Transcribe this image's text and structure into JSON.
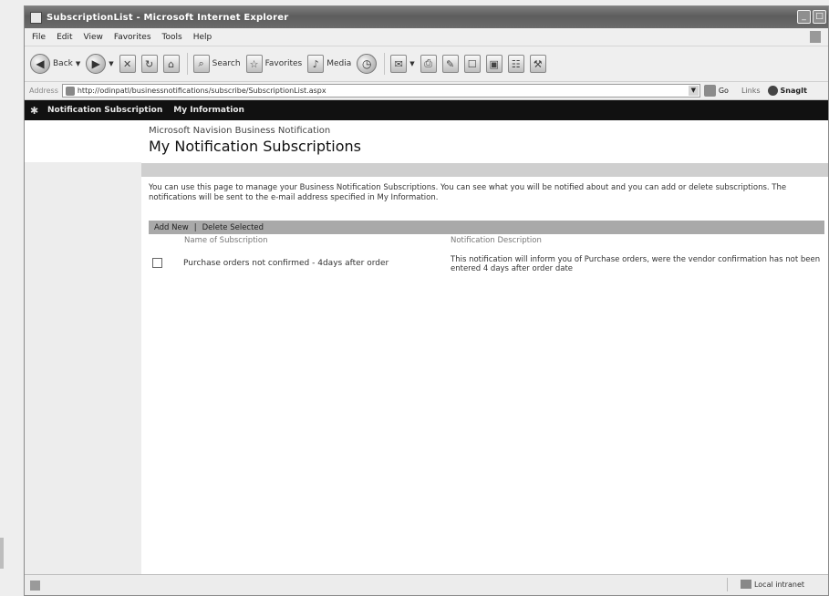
{
  "window": {
    "title": "SubscriptionList - Microsoft Internet Explorer"
  },
  "menubar": {
    "items": [
      "File",
      "Edit",
      "View",
      "Favorites",
      "Tools",
      "Help"
    ]
  },
  "toolbar": {
    "back_label": "Back",
    "search_label": "Search",
    "favorites_label": "Favorites",
    "media_label": "Media"
  },
  "addressbar": {
    "label": "Address",
    "url": "http://odinpatl/businessnotifications/subscribe/SubscriptionList.aspx",
    "go_label": "Go",
    "links_label": "Links",
    "snagit_label": "SnagIt"
  },
  "pagenav": {
    "links": [
      "Notification Subscription",
      "My Information"
    ]
  },
  "page": {
    "subtitle": "Microsoft Navision Business Notification",
    "title": "My Notification Subscriptions",
    "description": "You can use this page to manage your Business Notification Subscriptions. You can see what you will be notified about and you can add or delete subscriptions. The notifications will be sent to the e-mail address specified in My Information."
  },
  "actions": {
    "add_new": "Add New",
    "separator": "|",
    "delete_selected": "Delete Selected"
  },
  "table": {
    "columns": [
      "Name of Subscription",
      "Notification Description"
    ],
    "rows": [
      {
        "checked": false,
        "name": "Purchase orders not confirmed - 4days after order",
        "description": "This notification will inform you of Purchase orders, were the vendor confirmation has not been entered 4 days after order date"
      }
    ]
  },
  "statusbar": {
    "zone": "Local intranet"
  }
}
